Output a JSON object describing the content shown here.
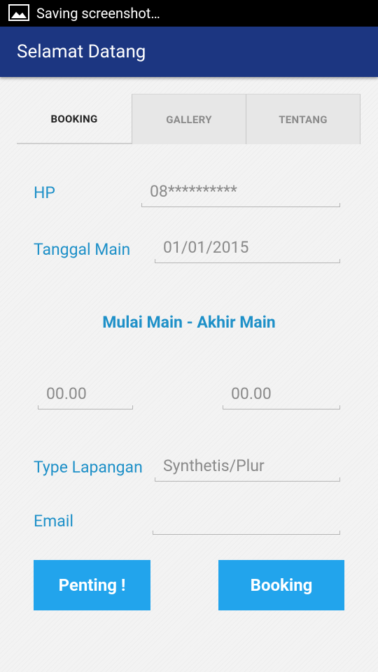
{
  "status_bar": {
    "text": "Saving screenshot…",
    "icon": "image-icon"
  },
  "app_bar": {
    "title": "Selamat Datang"
  },
  "tabs": [
    {
      "label": "BOOKING",
      "active": true
    },
    {
      "label": "GALLERY",
      "active": false
    },
    {
      "label": "TENTANG",
      "active": false
    }
  ],
  "form": {
    "hp": {
      "label": "HP",
      "value": "08**********"
    },
    "tanggal": {
      "label": "Tanggal Main",
      "value": "01/01/2015"
    },
    "time_section_title": "Mulai Main - Akhir Main",
    "start_time": "00.00",
    "end_time": "00.00",
    "type_lapangan": {
      "label": "Type Lapangan",
      "value": "Synthetis/Plur"
    },
    "email": {
      "label": "Email",
      "value": ""
    }
  },
  "buttons": {
    "penting": "Penting !",
    "booking": "Booking"
  },
  "colors": {
    "app_bar": "#1c3681",
    "accent": "#1e90c8",
    "button": "#22a4ec"
  }
}
